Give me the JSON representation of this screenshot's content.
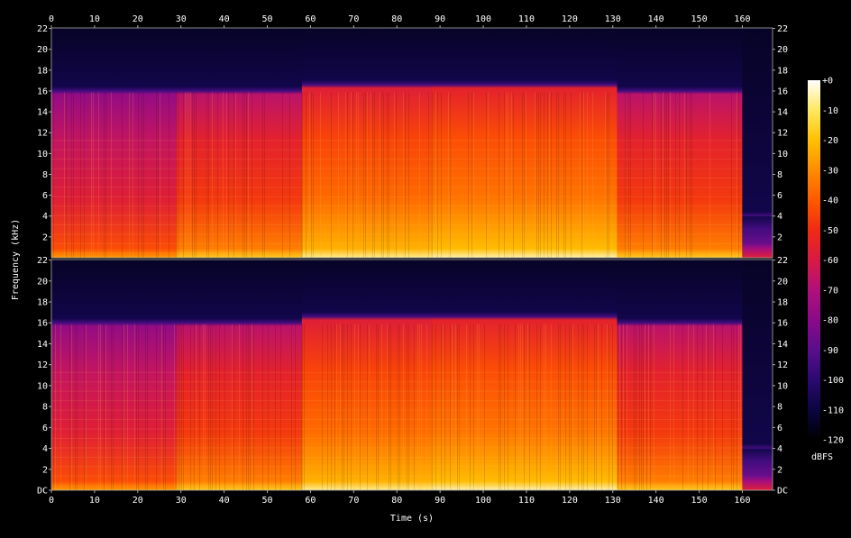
{
  "chart_data": {
    "type": "heatmap",
    "title": "",
    "xlabel": "Time (s)",
    "ylabel": "Frequency (kHz)",
    "colorbar_label": "dBFS",
    "xlim": [
      0,
      167
    ],
    "ylim_khz": [
      0,
      22.05
    ],
    "x_ticks": [
      0,
      10,
      20,
      30,
      40,
      50,
      60,
      70,
      80,
      90,
      100,
      110,
      120,
      130,
      140,
      150,
      160
    ],
    "y_ticks_top": [
      "22",
      "20",
      "18",
      "16",
      "14",
      "12",
      "10",
      "8",
      "6",
      "4",
      "2"
    ],
    "y_ticks_bottom": [
      "22",
      "20",
      "18",
      "16",
      "14",
      "12",
      "10",
      "8",
      "6",
      "4",
      "2",
      "DC"
    ],
    "colorbar_ticks": [
      "+0",
      "-10",
      "-20",
      "-30",
      "-40",
      "-50",
      "-60",
      "-70",
      "-80",
      "-90",
      "-100",
      "-110",
      "-120"
    ],
    "colorbar_range_dbfs": [
      -120,
      0
    ],
    "colormap": [
      "#000000",
      "#0b0540",
      "#2a0a70",
      "#5a0e8c",
      "#8a0a88",
      "#b0107a",
      "#d81a44",
      "#f02a14",
      "#ff5a00",
      "#ff8c00",
      "#ffc000",
      "#ffe860",
      "#ffffff"
    ],
    "channels": [
      "top",
      "bottom"
    ],
    "segments": [
      {
        "t_start": 0,
        "t_end": 29,
        "level_dbfs": -65,
        "cutoff_khz": 16
      },
      {
        "t_start": 29,
        "t_end": 58,
        "level_dbfs": -55,
        "cutoff_khz": 16
      },
      {
        "t_start": 58,
        "t_end": 88,
        "level_dbfs": -45,
        "cutoff_khz": 16.6
      },
      {
        "t_start": 88,
        "t_end": 131,
        "level_dbfs": -43,
        "cutoff_khz": 16.6
      },
      {
        "t_start": 131,
        "t_end": 160,
        "level_dbfs": -55,
        "cutoff_khz": 16
      },
      {
        "t_start": 160,
        "t_end": 167,
        "level_dbfs": -95,
        "cutoff_khz": 4
      }
    ]
  }
}
